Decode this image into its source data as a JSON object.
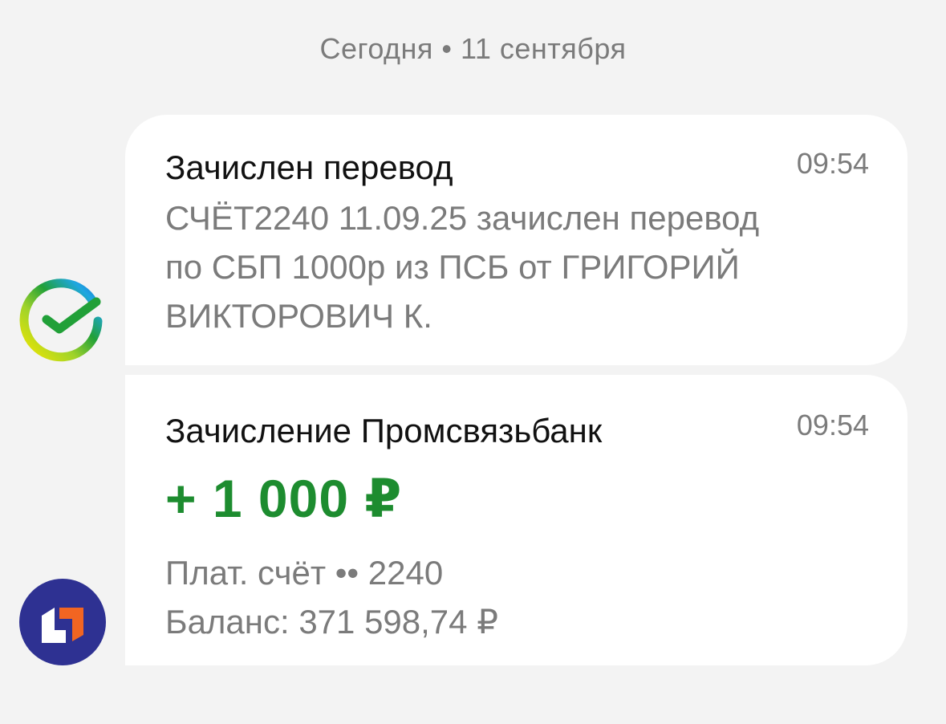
{
  "date_header": "Сегодня • 11 сентября",
  "messages": [
    {
      "sender_icon": "sber-logo-icon",
      "title": "Зачислен перевод",
      "time": "09:54",
      "body": "СЧЁТ2240 11.09.25 зачислен перевод по СБП 1000р из ПСБ от ГРИГОРИЙ ВИКТОРОВИЧ К."
    },
    {
      "sender_icon": "psb-logo-icon",
      "title": "Зачисление Промсвязьбанк",
      "time": "09:54",
      "amount": "+ 1 000 ₽",
      "account": "Плат. счёт •• 2240",
      "balance": "Баланс: 371 598,74 ₽"
    }
  ],
  "colors": {
    "background": "#f3f3f3",
    "bubble": "#ffffff",
    "amount_green": "#1d8c2f",
    "muted_text": "#7b7b7b",
    "psb_blue": "#2e3192",
    "psb_orange": "#f26522"
  }
}
